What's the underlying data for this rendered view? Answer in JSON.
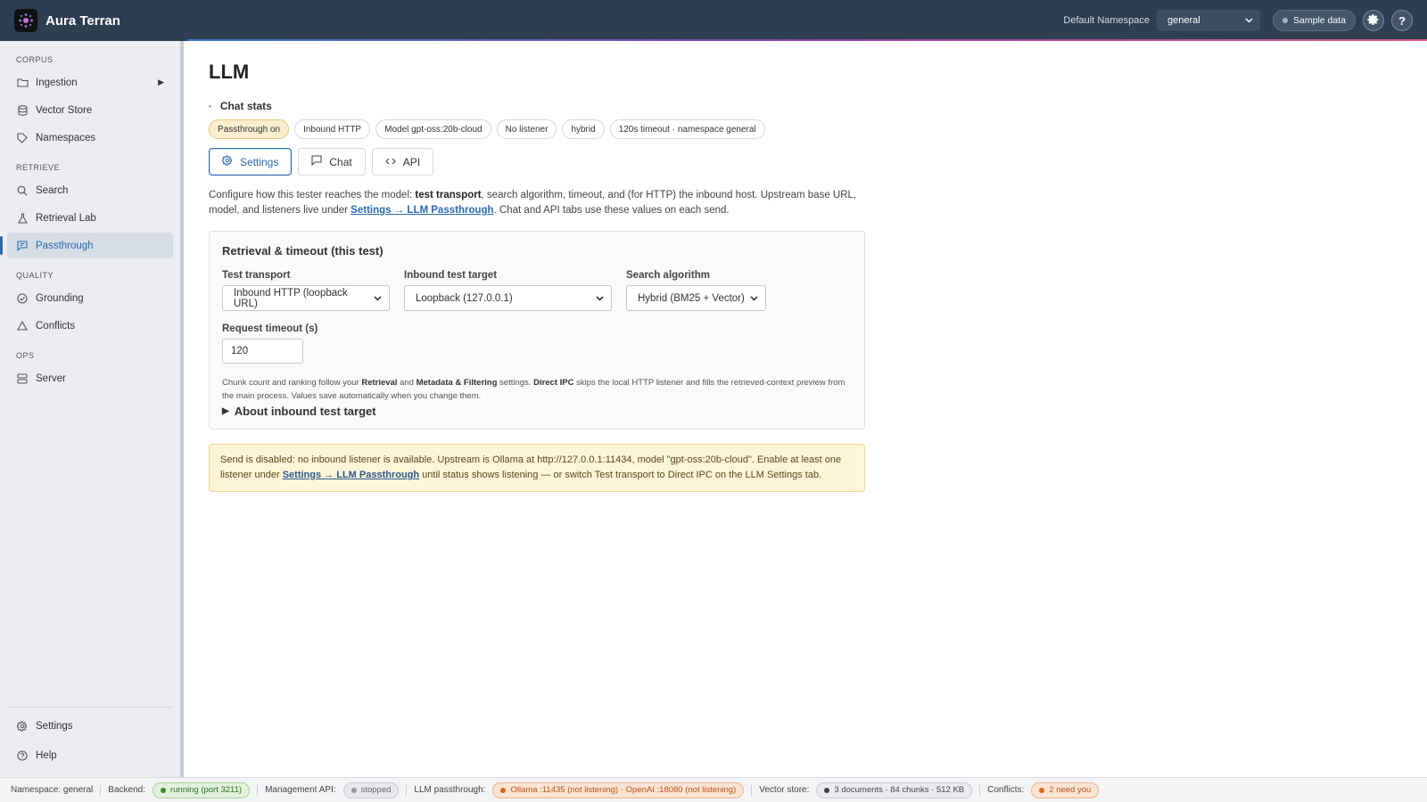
{
  "app": {
    "name": "Aura Terran"
  },
  "topbar": {
    "namespace_label": "Default Namespace",
    "namespace_value": "general",
    "sample_data_label": "Sample data",
    "settings_icon": "gear-icon",
    "help_glyph": "?"
  },
  "sidebar": {
    "sections": {
      "corpus": "CORPUS",
      "retrieve": "RETRIEVE",
      "quality": "QUALITY",
      "ops": "OPS"
    },
    "items": {
      "ingestion": "Ingestion",
      "vector_store": "Vector Store",
      "namespaces": "Namespaces",
      "search": "Search",
      "retrieval_lab": "Retrieval Lab",
      "passthrough": "Passthrough",
      "grounding": "Grounding",
      "conflicts": "Conflicts",
      "server": "Server",
      "settings": "Settings",
      "help": "Help"
    },
    "active": "passthrough"
  },
  "main": {
    "title": "LLM",
    "chat_stats_label": "Chat stats",
    "chips": {
      "passthrough": "Passthrough on",
      "inbound": "Inbound HTTP",
      "model": "Model gpt-oss:20b-cloud",
      "listener": "No listener",
      "algo": "hybrid",
      "timeout": "120s timeout · namespace general"
    },
    "tabs": {
      "settings": "Settings",
      "chat": "Chat",
      "api": "API"
    },
    "desc": {
      "p1": "Configure how this tester reaches the model: ",
      "b1": "test transport",
      "p2": ", search algorithm, timeout, and (for HTTP) the inbound host. Upstream base URL, model, and listeners live under ",
      "link": "Settings → LLM Passthrough",
      "p3": ". Chat and API tabs use these values on each send."
    },
    "card": {
      "title": "Retrieval & timeout (this test)",
      "transport_label": "Test transport",
      "transport_value": "Inbound HTTP (loopback URL)",
      "target_label": "Inbound test target",
      "target_value": "Loopback (127.0.0.1)",
      "algo_label": "Search algorithm",
      "algo_value": "Hybrid (BM25 + Vector)",
      "timeout_label": "Request timeout (s)",
      "timeout_value": "120",
      "hint_p1": "Chunk count and ranking follow your ",
      "hint_b1": "Retrieval",
      "hint_p2": " and ",
      "hint_b2": "Metadata & Filtering",
      "hint_p3": " settings. ",
      "hint_b3": "Direct IPC",
      "hint_p4": " skips the local HTTP listener and fills the retrieved-context preview from the main process. Values save automatically when you change them.",
      "details_label": "About inbound test target"
    },
    "warning": {
      "p1": "Send is disabled: no inbound listener is available. Upstream is Ollama at http://127.0.0.1:11434, model \"gpt-oss:20b-cloud\". Enable at least one listener under ",
      "link": "Settings → LLM Passthrough",
      "p2": " until status shows listening — or switch Test transport to Direct IPC on the LLM Settings tab."
    }
  },
  "statusbar": {
    "namespace": "Namespace: general",
    "backend_label": "Backend:",
    "backend_value": "running (port 3211)",
    "mgmt_label": "Management API:",
    "mgmt_value": "stopped",
    "llm_label": "LLM passthrough:",
    "llm_value": "Ollama :11435 (not listening) · OpenAI :18080 (not listening)",
    "vector_label": "Vector store:",
    "vector_value": "3 documents · 84 chunks · 512 KB",
    "conflicts_label": "Conflicts:",
    "conflicts_value": "2 need you"
  },
  "colors": {
    "topbar_bg": "#2c3e50",
    "accent": "#2a6ab0",
    "warning_bg": "#fdf5d8",
    "status_ok": "#3f8a2f",
    "status_error": "#e1661f"
  }
}
